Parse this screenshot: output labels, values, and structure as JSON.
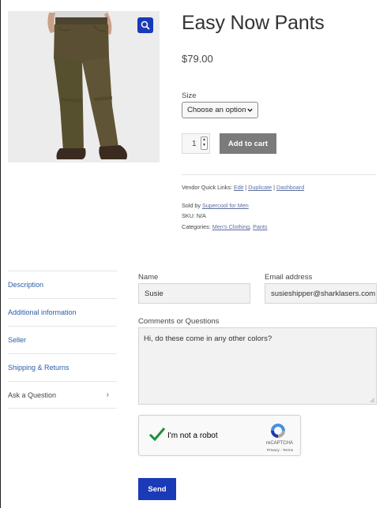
{
  "product": {
    "title": "Easy Now Pants",
    "price": "$79.00",
    "size_label": "Size",
    "size_select": "Choose an option",
    "quantity": "1",
    "add_to_cart": "Add to cart"
  },
  "meta": {
    "vendor_prefix": "Vendor Quick Links:",
    "vendor_links": [
      "Edit",
      "Duplicate",
      "Dashboard"
    ],
    "sold_by_prefix": "Sold by",
    "sold_by": "Supercool for Men",
    "sku": "SKU: N/A",
    "categories_prefix": "Categories:",
    "categories": [
      "Men's Clothing",
      "Pants"
    ]
  },
  "tabs": [
    {
      "label": "Description"
    },
    {
      "label": "Additional information"
    },
    {
      "label": "Seller"
    },
    {
      "label": "Shipping & Returns"
    },
    {
      "label": "Ask a Question",
      "arrow": "›"
    }
  ],
  "form": {
    "name_label": "Name",
    "name_value": "Susie",
    "email_label": "Email address",
    "email_value": "susieshipper@sharklasers.com",
    "comments_label": "Comments or Questions",
    "comments_value": "Hi, do these come in any other colors?",
    "captcha_text": "I'm not a robot",
    "captcha_brand": "reCAPTCHA",
    "captcha_fine": "Privacy - Terms",
    "send_label": "Send"
  },
  "colors": {
    "accent": "#1a3ab8",
    "link": "#2c5da8",
    "cart_button": "#7b7b7b",
    "pants": "#5a4f32"
  }
}
